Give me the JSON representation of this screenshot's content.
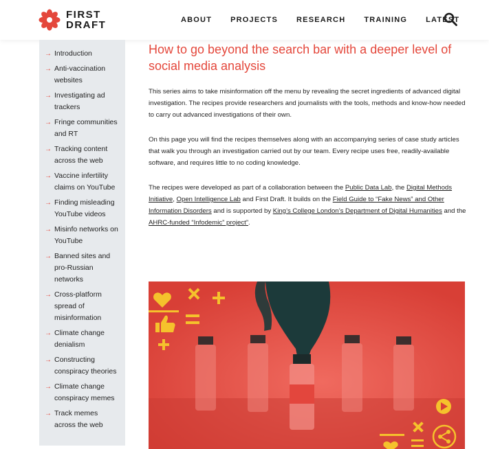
{
  "header": {
    "logo_line1": "FIRST",
    "logo_line2": "DRAFT",
    "nav": [
      "ABOUT",
      "PROJECTS",
      "RESEARCH",
      "TRAINING",
      "LATEST"
    ]
  },
  "sidebar": {
    "items": [
      "Introduction",
      "Anti-vaccination websites",
      "Investigating ad trackers",
      "Fringe communities and RT",
      "Tracking content across the web",
      "Vaccine infertility claims on YouTube",
      "Finding misleading YouTube videos",
      "Misinfo networks on YouTube",
      "Banned sites and pro-Russian networks",
      "Cross-platform spread of misinformation",
      "Climate change denialism",
      "Constructing conspiracy theories",
      "Climate change conspiracy memes",
      "Track memes across the web"
    ]
  },
  "main": {
    "title": "How to go beyond the search bar with a deeper level of social media analysis",
    "p1": "This series aims to take misinformation off the menu by revealing the secret ingredients of advanced digital investigation. The recipes provide researchers and journalists with the tools, methods and know-how needed to carry out advanced investigations of their own.",
    "p2": "On this page you will find the recipes themselves along with an accompanying series of case study articles that walk you through an investigation carried out by our team. Every recipe uses free, readily-available software, and requires little to no coding knowledge.",
    "p3": {
      "t1": "The recipes were developed as part of a collaboration between the ",
      "l1": "Public Data Lab",
      "t2": ", the ",
      "l2": "Digital Methods Initiative",
      "t3": ", ",
      "l3": "Open Intelligence Lab",
      "t4": " and First Draft. It builds on the ",
      "l4": "Field Guide to “Fake News” and Other Information Disorders",
      "t5": " and is supported by ",
      "l5": "King’s College London’s Department of Digital Humanities",
      "t6": " and the ",
      "l6": "AHRC-funded “Infodemic” project”",
      "t7": "."
    }
  },
  "colors": {
    "accent": "#e4473b",
    "hero_red": "#e5534a",
    "hero_yellow": "#f5c22c",
    "sidebar_bg": "#e7eaed"
  }
}
